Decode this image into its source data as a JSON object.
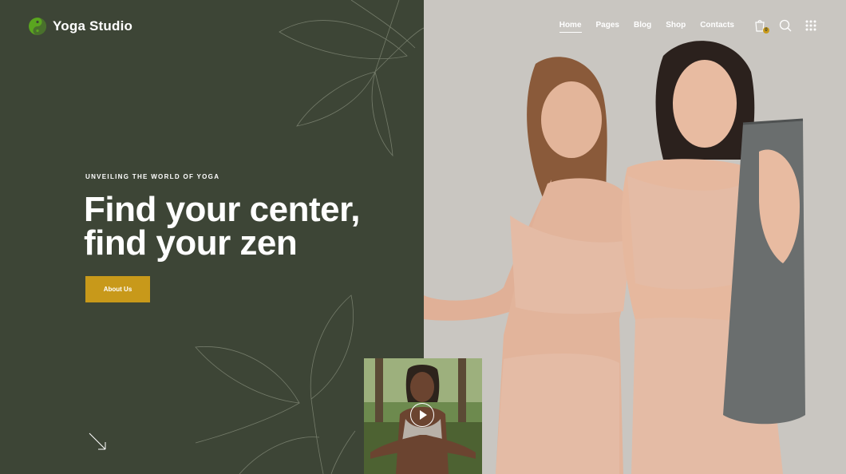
{
  "brand": {
    "name": "Yoga Studio"
  },
  "nav": {
    "items": [
      "Home",
      "Pages",
      "Blog",
      "Shop",
      "Contacts"
    ],
    "active": "Home"
  },
  "header_icons": {
    "cart": "cart-icon",
    "search": "search-icon",
    "menu": "grid-menu-icon",
    "cart_count": "0"
  },
  "hero": {
    "eyebrow": "UNVEILING THE WORLD OF YOGA",
    "headline_line1": "Find your center,",
    "headline_line2": "find your zen",
    "cta_label": "About Us"
  },
  "colors": {
    "background": "#3d4536",
    "accent": "#c8991a",
    "text": "#ffffff",
    "photo_bg": "#c9c6c1"
  },
  "scroll_indicator": "arrow-down-right-icon",
  "video_thumb": {
    "icon": "play-icon"
  }
}
